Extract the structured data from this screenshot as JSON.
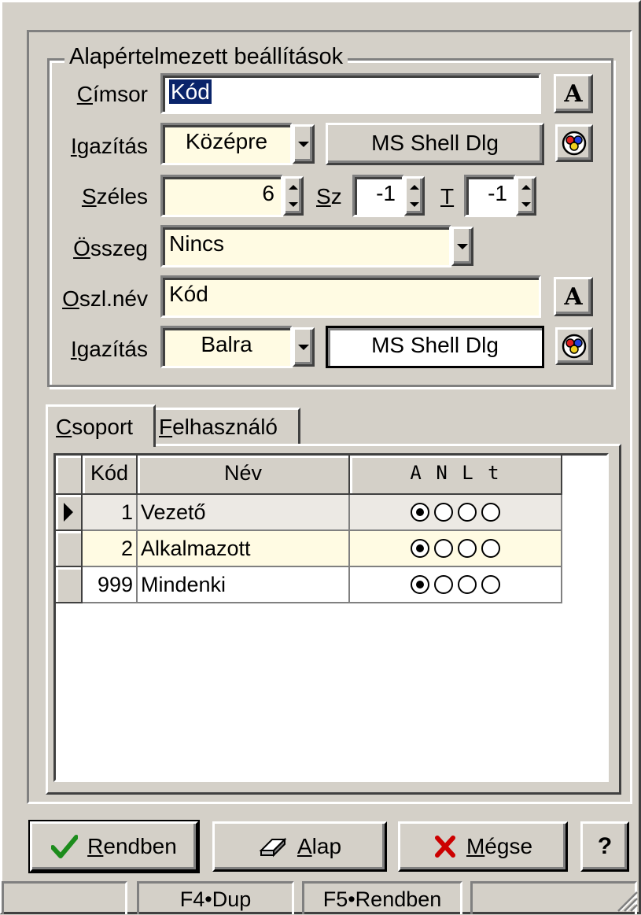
{
  "group": {
    "title": "Alapértelmezett beállítások",
    "cimsor": {
      "label_u": "C",
      "label_rest": "ímsor",
      "value": "Kód"
    },
    "igazitas1": {
      "label_u": "I",
      "label_rest": "gazítás",
      "value": "Középre",
      "font": "MS Shell Dlg"
    },
    "széles": {
      "label_u": "S",
      "label_rest": "zéles",
      "value": "6"
    },
    "sz": {
      "label_u": "S",
      "label_rest": "z",
      "value": "-1"
    },
    "t": {
      "label_u": "T",
      "value": "-1"
    },
    "osszeg": {
      "label_u": "Ö",
      "label_rest": "sszeg",
      "value": "Nincs"
    },
    "oszlnev": {
      "label_u": "O",
      "label_rest": "szl.név",
      "value": "Kód"
    },
    "igazitas2": {
      "label_u": "I",
      "label_rest": "gazítás",
      "value": "Balra",
      "font": "MS Shell Dlg"
    },
    "font_button": "A"
  },
  "tabs": [
    {
      "u": "C",
      "rest": "soport"
    },
    {
      "u": "F",
      "rest": "elhasználó"
    }
  ],
  "grid": {
    "headers": {
      "kod": "Kód",
      "nev": "Név",
      "flags": "A N L t"
    },
    "rows": [
      {
        "kod": "1",
        "nev": "Vezető",
        "radio": [
          true,
          false,
          false,
          false
        ],
        "current": true
      },
      {
        "kod": "2",
        "nev": "Alkalmazott",
        "radio": [
          true,
          false,
          false,
          false
        ],
        "current": false
      },
      {
        "kod": "999",
        "nev": "Mindenki",
        "radio": [
          true,
          false,
          false,
          false
        ],
        "current": false
      }
    ],
    "row_colors": [
      "#ece9e4",
      "#fffbe3",
      "#ffffff"
    ]
  },
  "buttons": {
    "ok": {
      "u": "R",
      "rest": "endben"
    },
    "alap": {
      "u": "A",
      "rest": "lap"
    },
    "cancel": {
      "u": "M",
      "rest": "égse"
    },
    "help": "?"
  },
  "status": [
    "",
    "F4•Dup",
    "F5•Rendben",
    ""
  ],
  "colors": {
    "face": "#d4d0c8",
    "field": "#fffbe3",
    "selection": "#0a246a",
    "check": "#1c8c1c",
    "cross": "#cc0000"
  }
}
